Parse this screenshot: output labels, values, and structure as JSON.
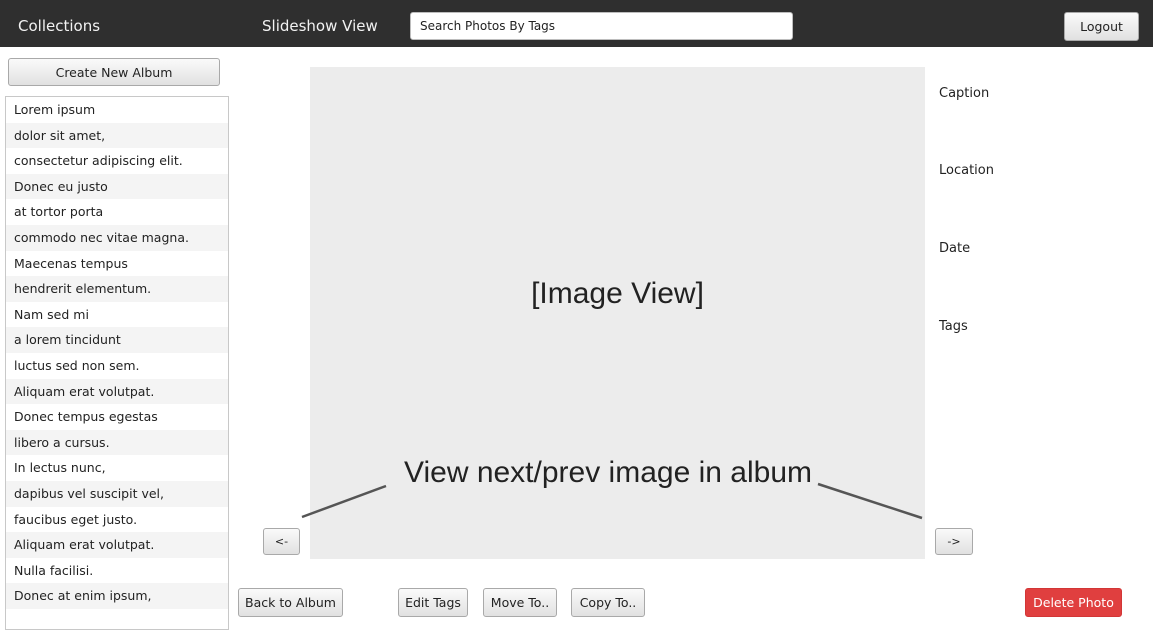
{
  "topbar": {
    "collections": "Collections",
    "slideshow_view": "Slideshow View",
    "search_placeholder": "Search Photos By Tags",
    "logout": "Logout"
  },
  "sidebar": {
    "create_album": "Create New Album",
    "albums": [
      "Lorem ipsum",
      "dolor sit amet,",
      "consectetur adipiscing elit.",
      "Donec eu justo",
      "at tortor porta",
      "commodo nec vitae magna.",
      "Maecenas tempus",
      "hendrerit elementum.",
      "Nam sed mi",
      "a lorem tincidunt",
      "luctus sed non sem.",
      "Aliquam erat volutpat.",
      "Donec tempus egestas",
      "libero a cursus.",
      "In lectus nunc,",
      "dapibus vel suscipit vel,",
      "faucibus eget justo.",
      "Aliquam erat volutpat.",
      "Nulla facilisi.",
      "Donec at enim ipsum,"
    ]
  },
  "main": {
    "image_placeholder": "[Image View]",
    "annotation": "View next/prev image in album",
    "prev": "<-",
    "next": "->"
  },
  "details": {
    "caption": "Caption",
    "location": "Location",
    "date": "Date",
    "tags": "Tags"
  },
  "actions": {
    "back_to_album": "Back to Album",
    "edit_tags": "Edit Tags",
    "move_to": "Move To..",
    "copy_to": "Copy To..",
    "delete_photo": "Delete Photo"
  },
  "colors": {
    "topbar_bg": "#2f2f2f",
    "delete_bg": "#e03f3f",
    "image_bg": "#ececec"
  }
}
